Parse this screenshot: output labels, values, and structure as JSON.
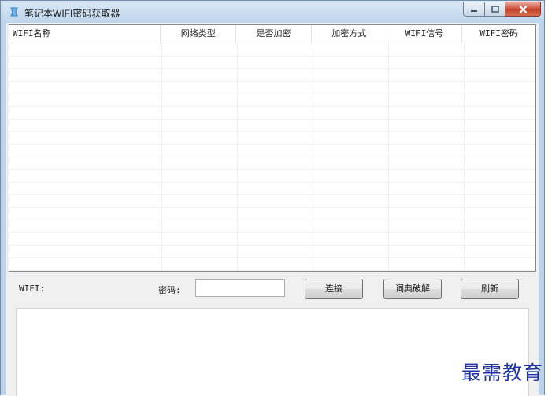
{
  "window": {
    "title": "笔记本WIFI密码获取器",
    "icon": "wifi-app-icon",
    "controls": {
      "minimize": "minimize-icon",
      "maximize": "maximize-icon",
      "close": "close-icon"
    }
  },
  "table": {
    "columns": [
      "WIFI名称",
      "网络类型",
      "是否加密",
      "加密方式",
      "WIFI信号",
      "WIFI密码"
    ],
    "rows": []
  },
  "form": {
    "wifi_label": "WIFI:",
    "wifi_value": "",
    "password_label": "密码:",
    "password_value": "",
    "connect_label": "连接",
    "dictionary_crack_label": "词典破解",
    "refresh_label": "刷新"
  },
  "log": {
    "text": ""
  },
  "watermark": "最需教育",
  "colors": {
    "title_bar": "#bed5ec",
    "close_button": "#c7432b",
    "watermark": "#1f33a6"
  }
}
